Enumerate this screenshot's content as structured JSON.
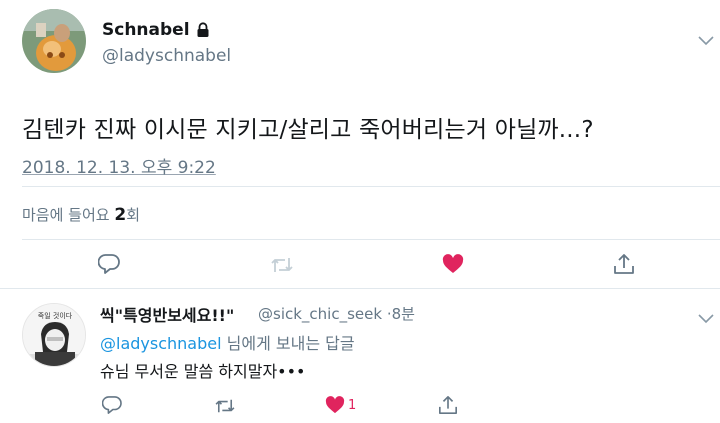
{
  "tweet": {
    "display_name": "Schnabel",
    "handle": "@ladyschnabel",
    "text": "김텐카 진짜 이시문 지키고/살리고 죽어버리는거 아닐까...?",
    "timestamp": "2018. 12. 13. 오후 9:22",
    "likes_label": "마음에 들어요",
    "likes_count": "2",
    "likes_unit": "회",
    "protected_icon": "lock-icon",
    "actions": [
      {
        "name": "reply-icon",
        "liked": false
      },
      {
        "name": "retweet-icon",
        "disabled": true
      },
      {
        "name": "heart-icon",
        "liked": true
      },
      {
        "name": "share-icon"
      }
    ]
  },
  "reply": {
    "display_name": "씩\"특영반보세요!!\"",
    "handle": "@sick_chic_seek",
    "separator": "·",
    "time": "8분",
    "replying_to_user": "@ladyschnabel",
    "replying_to_suffix": " 님에게 보내는 답글",
    "text": "슈님 무서운 말씀 하지말자•••",
    "avatar_text": "죽일 것이다",
    "like_count": "1"
  },
  "colors": {
    "text": "#14171a",
    "secondary": "#657786",
    "accent": "#1b95e0",
    "like": "#e0245e",
    "divider": "#e1e8ed"
  }
}
